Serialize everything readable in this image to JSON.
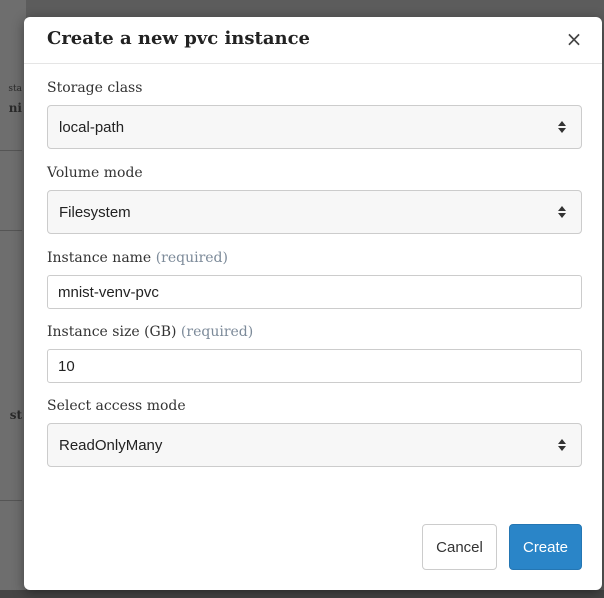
{
  "background": {
    "fragments": [
      "sta",
      "ni",
      "st"
    ]
  },
  "modal": {
    "title": "Create a new pvc instance",
    "close_glyph": "×",
    "fields": {
      "storage_class": {
        "label": "Storage class",
        "value": "local-path"
      },
      "volume_mode": {
        "label": "Volume mode",
        "value": "Filesystem"
      },
      "instance_name": {
        "label": "Instance name",
        "required": "(required)",
        "value": "mnist-venv-pvc"
      },
      "instance_size": {
        "label": "Instance size (GB)",
        "required": "(required)",
        "value": "10"
      },
      "access_mode": {
        "label": "Select access mode",
        "value": "ReadOnlyMany"
      }
    },
    "buttons": {
      "cancel": "Cancel",
      "create": "Create"
    }
  },
  "colors": {
    "primary": "#2a85c8",
    "required_hint": "#7c8a99",
    "overlay": "#4a4a4a"
  },
  "icons": {
    "close": "close-icon",
    "select_caret": "sort-caret-icon"
  }
}
